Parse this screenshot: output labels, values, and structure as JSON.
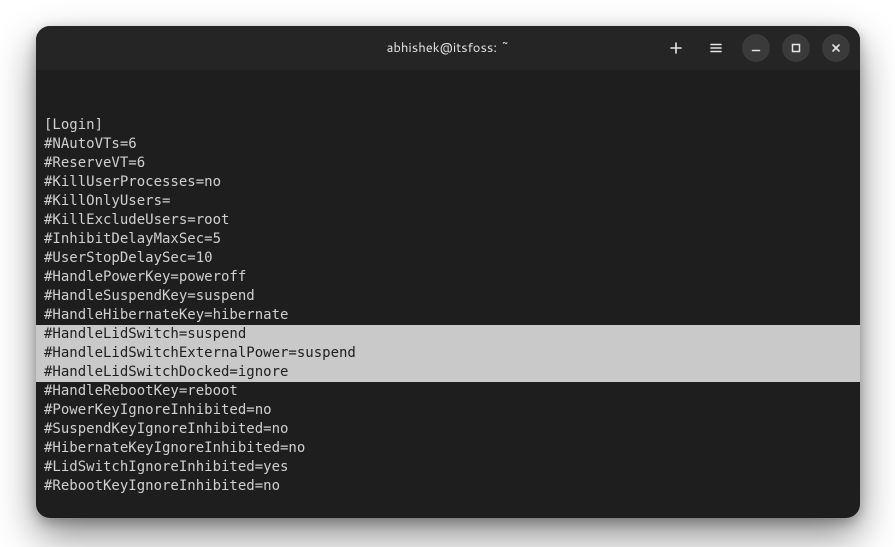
{
  "titlebar": {
    "title": "abhishek@itsfoss: ~"
  },
  "content": {
    "lines": [
      {
        "text": "[Login]",
        "highlighted": false
      },
      {
        "text": "#NAutoVTs=6",
        "highlighted": false
      },
      {
        "text": "#ReserveVT=6",
        "highlighted": false
      },
      {
        "text": "#KillUserProcesses=no",
        "highlighted": false
      },
      {
        "text": "#KillOnlyUsers=",
        "highlighted": false
      },
      {
        "text": "#KillExcludeUsers=root",
        "highlighted": false
      },
      {
        "text": "#InhibitDelayMaxSec=5",
        "highlighted": false
      },
      {
        "text": "#UserStopDelaySec=10",
        "highlighted": false
      },
      {
        "text": "#HandlePowerKey=poweroff",
        "highlighted": false
      },
      {
        "text": "#HandleSuspendKey=suspend",
        "highlighted": false
      },
      {
        "text": "#HandleHibernateKey=hibernate",
        "highlighted": false
      },
      {
        "text": "#HandleLidSwitch=suspend",
        "highlighted": true
      },
      {
        "text": "#HandleLidSwitchExternalPower=suspend",
        "highlighted": true
      },
      {
        "text": "#HandleLidSwitchDocked=ignore",
        "highlighted": true
      },
      {
        "text": "#HandleRebootKey=reboot",
        "highlighted": false
      },
      {
        "text": "#PowerKeyIgnoreInhibited=no",
        "highlighted": false
      },
      {
        "text": "#SuspendKeyIgnoreInhibited=no",
        "highlighted": false
      },
      {
        "text": "#HibernateKeyIgnoreInhibited=no",
        "highlighted": false
      },
      {
        "text": "#LidSwitchIgnoreInhibited=yes",
        "highlighted": false
      },
      {
        "text": "#RebootKeyIgnoreInhibited=no",
        "highlighted": false
      }
    ]
  }
}
